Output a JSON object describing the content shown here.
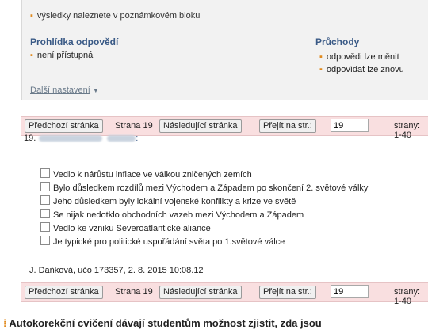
{
  "summary": {
    "result_note": "výsledky naleznete v poznámkovém bloku",
    "review_heading": "Prohlídka odpovědí",
    "review_items": [
      "není přístupná"
    ],
    "pass_heading": "Průchody",
    "pass_items": [
      "odpovědi lze měnit",
      "odpovídat lze znovu"
    ],
    "more_settings": "Další nastavení"
  },
  "pager": {
    "prev_label": "Předchozí stránka",
    "page_text": "Strana 19",
    "next_label": "Následující stránka",
    "goto_label": "Přejít na str.:",
    "page_value": "19",
    "range_label": "strany: 1-40"
  },
  "question": {
    "number": "19.",
    "options": [
      "Vedlo k nárůstu inflace ve válkou zničených zemích",
      "Bylo důsledkem rozdílů mezi Východem a Západem po skončení 2. světové války",
      "Jeho důsledkem byly lokální vojenské konflikty a krize ve světě",
      "Se nijak nedotklo obchodních vazeb mezi Východem a Západem",
      "Vedlo ke vzniku Severoatlantické aliance",
      "Je typické pro politické uspořádání světa po 1.světové válce"
    ],
    "signature": "J. Daňková, učo 173357, 2. 8. 2015 10:08.12"
  },
  "footer": {
    "text": "Autokorekční cvičení dávají studentům možnost zjistit, zda jsou"
  },
  "colors": {
    "accent": "#e08a1e",
    "pager_bg": "#f9dfe0",
    "heading": "#3a5a86"
  }
}
